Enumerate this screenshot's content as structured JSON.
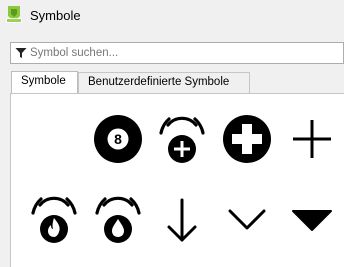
{
  "window": {
    "title": "Symbole",
    "app_icon": "qgis-logo-icon"
  },
  "search": {
    "placeholder": "Symbol suchen...",
    "value": "",
    "icon": "filter-icon"
  },
  "tabs": [
    {
      "label": "Symbole",
      "active": true
    },
    {
      "label": "Benutzerdefinierte Symbole",
      "active": false
    }
  ],
  "symbols": [
    {
      "name": "billiard-8-ball-icon",
      "glyph": "8"
    },
    {
      "name": "hospital-alert-icon"
    },
    {
      "name": "medical-cross-circle-icon"
    },
    {
      "name": "plus-icon"
    },
    {
      "name": "fire-alert-icon"
    },
    {
      "name": "water-drop-alert-icon"
    },
    {
      "name": "arrow-down-icon"
    },
    {
      "name": "chevron-down-icon"
    },
    {
      "name": "triangle-down-icon"
    }
  ]
}
